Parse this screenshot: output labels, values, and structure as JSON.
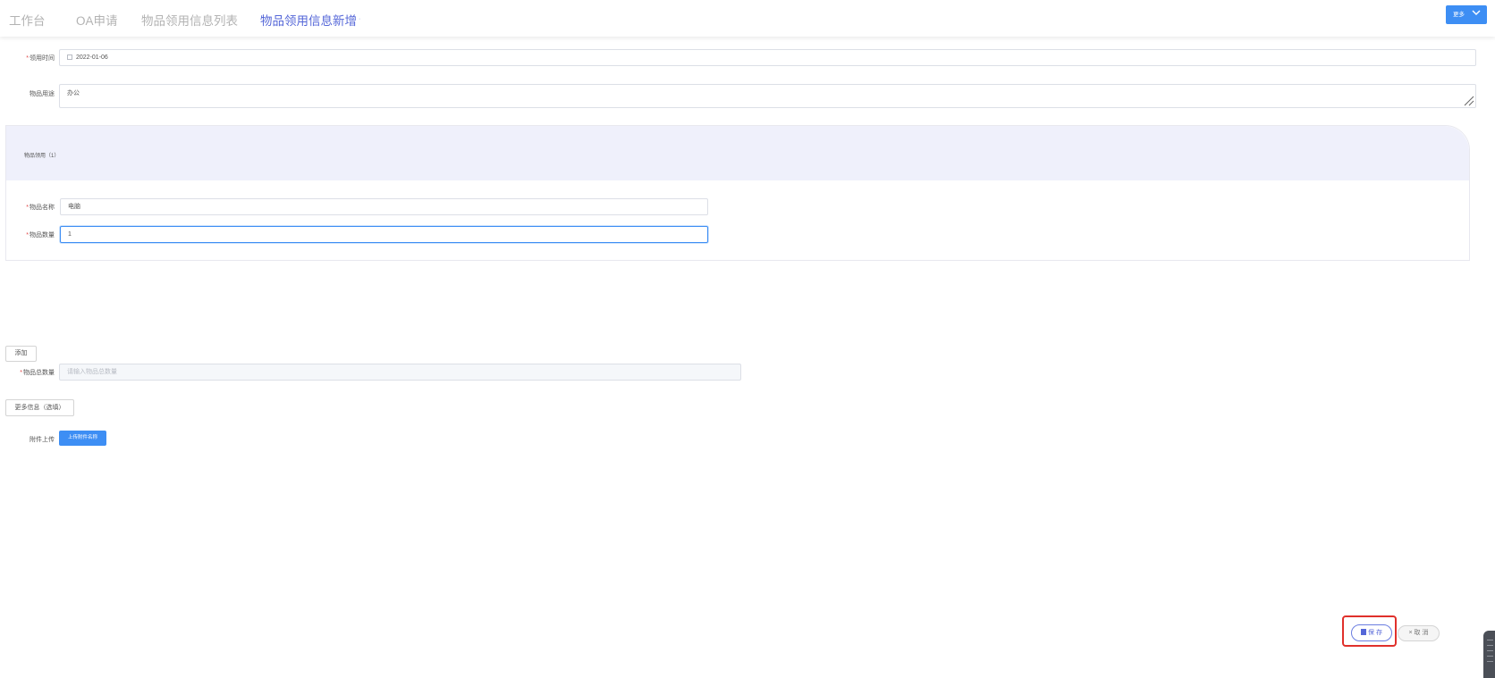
{
  "tabs": [
    "工作台",
    "OA申请",
    "物品领用信息列表",
    "物品领用信息新增"
  ],
  "active_tab_index": 3,
  "tab_close_glyph": "·",
  "header": {
    "more_label": "更多"
  },
  "form": {
    "receive_time": {
      "label": "领用时间",
      "value": "2022-01-06",
      "required": true
    },
    "purpose": {
      "label": "物品用途",
      "value": "办公"
    },
    "section_title": "物品领用（1）",
    "item_name": {
      "label": "物品名称",
      "value": "电脑",
      "required": true
    },
    "item_qty": {
      "label": "物品数量",
      "value": "1",
      "required": true
    },
    "add_label": "添加",
    "total_qty": {
      "label": "物品总数量",
      "placeholder": "请输入物品总数量",
      "required": true
    },
    "more_info_label": "更多信息（选填）",
    "attachment": {
      "label": "附件上传",
      "button_label": "上传附件名称"
    }
  },
  "footer": {
    "save_label": "保 存",
    "cancel_label": "× 取 消"
  },
  "colors": {
    "accent": "#5567d8",
    "primary": "#3d8ef4",
    "required": "#e24a4a",
    "highlight": "#e0302b"
  }
}
